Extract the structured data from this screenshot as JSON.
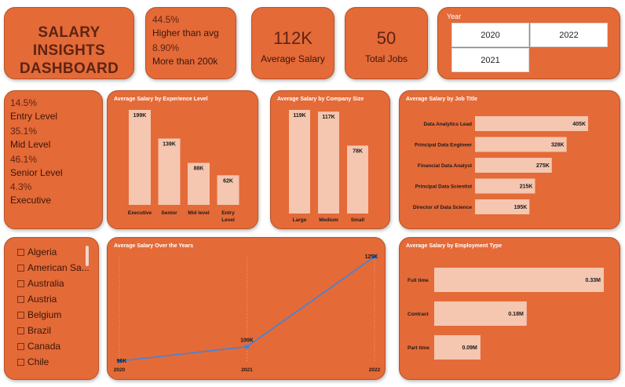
{
  "dashboard": {
    "title_lines": [
      "SALARY",
      "INSIGHTS",
      "DASHBOARD"
    ]
  },
  "kpis": {
    "higher_than_avg": {
      "value": "44.5%",
      "label": "Higher than avg"
    },
    "more_than_200k": {
      "value": "8.90%",
      "label": "More than 200k"
    },
    "avg_salary": {
      "value": "112K",
      "label": "Average Salary"
    },
    "total_jobs": {
      "value": "50",
      "label": "Total Jobs"
    }
  },
  "year_slicer": {
    "title": "Year",
    "options": [
      "2020",
      "2022",
      "2021"
    ]
  },
  "levels": [
    {
      "pct": "14.5%",
      "label": "Entry Level"
    },
    {
      "pct": "35.1%",
      "label": "Mid Level"
    },
    {
      "pct": "46.1%",
      "label": "Senior Level"
    },
    {
      "pct": "4.3%",
      "label": "Executive"
    }
  ],
  "countries": [
    "Algeria",
    "American Sa...",
    "Australia",
    "Austria",
    "Belgium",
    "Brazil",
    "Canada",
    "Chile"
  ],
  "colors": {
    "card": "#e46a38",
    "bar": "#f5c6b0",
    "line": "#3a86e0",
    "title": "#5e2412"
  },
  "chart_data": [
    {
      "type": "bar",
      "title": "Average Salary by Experience Level",
      "categories": [
        "Executive",
        "Senior",
        "Mid level",
        "Entry Level"
      ],
      "values": [
        199,
        139,
        88,
        62
      ],
      "labels": [
        "199K",
        "139K",
        "88K",
        "62K"
      ],
      "ylim": [
        0,
        199
      ]
    },
    {
      "type": "bar",
      "title": "Average Salary by Company Size",
      "categories": [
        "Large",
        "Medium",
        "Small"
      ],
      "values": [
        119,
        117,
        78
      ],
      "labels": [
        "119K",
        "117K",
        "78K"
      ],
      "ylim": [
        0,
        119
      ]
    },
    {
      "type": "bar",
      "orientation": "horizontal",
      "title": "Average Salary by Job Title",
      "categories": [
        "Data Analytics Lead",
        "Principal Data Engineer",
        "Financial Data Analyst",
        "Principal Data Scientist",
        "Director of Data Science"
      ],
      "values": [
        405,
        328,
        275,
        215,
        195
      ],
      "labels": [
        "405K",
        "328K",
        "275K",
        "215K",
        "195K"
      ],
      "xlim": [
        0,
        405
      ]
    },
    {
      "type": "line",
      "title": "Average Salary Over the Years",
      "x": [
        "2020",
        "2021",
        "2022"
      ],
      "values": [
        96,
        100,
        125
      ],
      "labels": [
        "96K",
        "100K",
        "125K"
      ],
      "ylim": [
        96,
        125
      ]
    },
    {
      "type": "bar",
      "orientation": "horizontal",
      "title": "Average Salary by Employment Type",
      "categories": [
        "Full time",
        "Contract",
        "Part time"
      ],
      "values": [
        0.33,
        0.18,
        0.09
      ],
      "labels": [
        "0.33M",
        "0.18M",
        "0.09M"
      ],
      "xlim": [
        0,
        0.33
      ]
    }
  ]
}
